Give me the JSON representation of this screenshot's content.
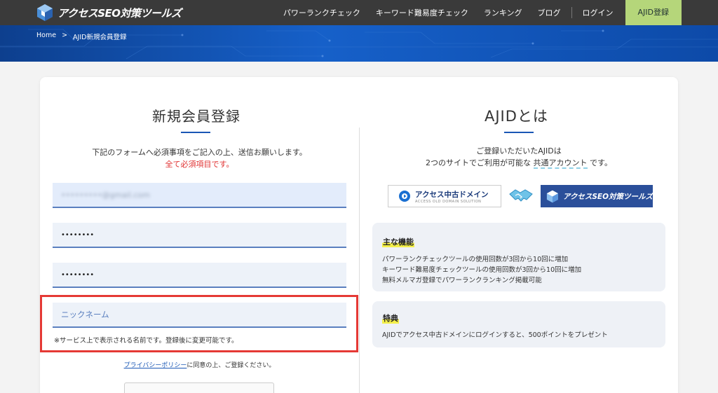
{
  "header": {
    "logo_text": "アクセスSEO対策ツールズ",
    "nav": [
      {
        "label": "パワーランクチェック"
      },
      {
        "label": "キーワード難易度チェック"
      },
      {
        "label": "ランキング"
      },
      {
        "label": "ブログ"
      }
    ],
    "login_label": "ログイン",
    "register_label": "AJID登録"
  },
  "breadcrumb": {
    "home": "Home",
    "separator": ">",
    "current": "AJID新規会員登録"
  },
  "form": {
    "title": "新規会員登録",
    "description": "下記のフォームへ必須事項をご記入の上、送信お願いします。",
    "required_notice": "全て必須項目です。",
    "email_value": "•••••••••@gmail.com",
    "password_value": "••••••••",
    "password_confirm_value": "••••••••",
    "nickname_placeholder": "ニックネーム",
    "nickname_note": "※サービス上で表示される名前です。登録後に変更可能です。",
    "privacy_link": "プライバシーポリシー",
    "privacy_text": "に同意の上、ご登録ください。"
  },
  "about": {
    "title": "AJIDとは",
    "line1": "ご登録いただいたAJIDは",
    "line2_pre": "2つのサイトでご利用が可能な ",
    "line2_highlight": "共通アカウント",
    "line2_post": " です。",
    "logo1_name": "アクセス中古ドメイン",
    "logo1_sub": "ACCESS OLD DOMAIN SOLUTION",
    "logo2_name": "アクセスSEO対策ツールズ",
    "features_title": "主な機能",
    "features": [
      "パワーランクチェックツールの使用回数が3回から10回に増加",
      "キーワード難易度チェックツールの使用回数が3回から10回に増加",
      "無料メルマガ登録でパワーランクランキング掲載可能"
    ],
    "bonus_title": "特典",
    "bonus_text": "AJIDでアクセス中古ドメインにログインすると、500ポイントをプレゼント"
  },
  "colors": {
    "header_bg": "#3a3a3a",
    "cta_bg": "#b5d67a",
    "hero_blue": "#1660c9",
    "accent_blue": "#1a57b5",
    "required_red": "#e03030",
    "highlight_border": "#e53935"
  }
}
